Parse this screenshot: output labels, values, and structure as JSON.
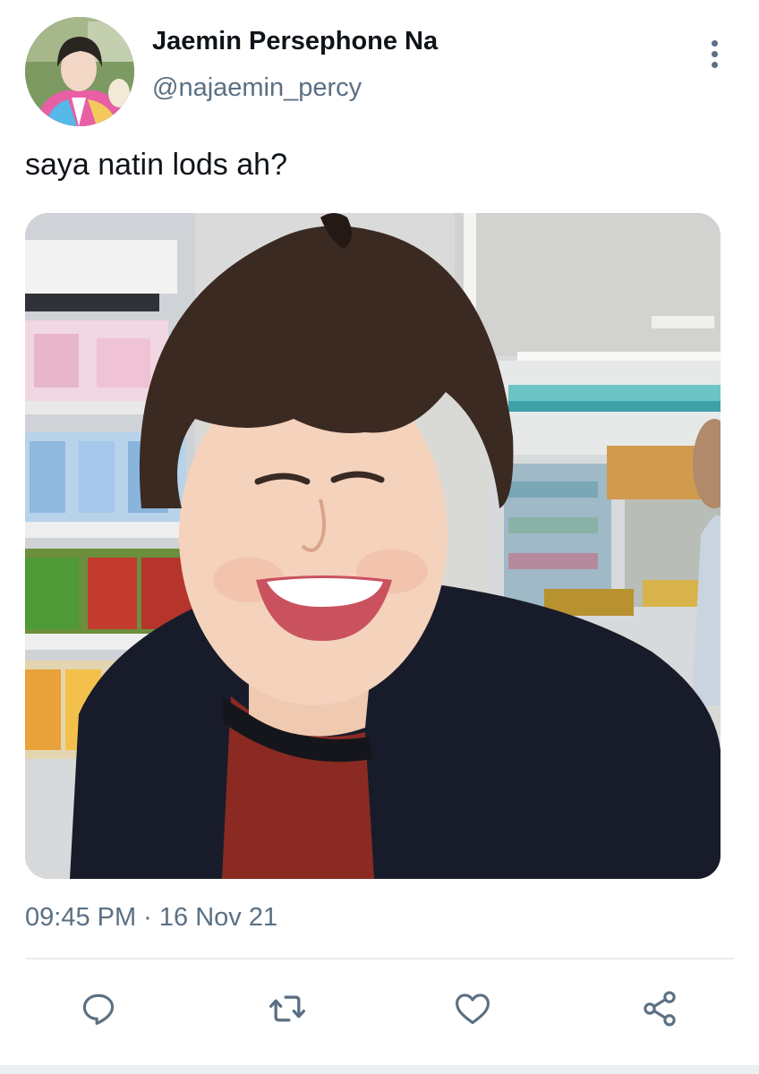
{
  "tweet": {
    "author": {
      "display_name": "Jaemin Persephone Na",
      "handle": "@najaemin_percy"
    },
    "text": "saya natin lods ah?",
    "timestamp": "09:45 PM · 16 Nov 21"
  },
  "actions": [
    {
      "name": "reply",
      "icon": "speech-bubble-icon"
    },
    {
      "name": "retweet",
      "icon": "retweet-arrows-icon"
    },
    {
      "name": "like",
      "icon": "heart-icon"
    },
    {
      "name": "share",
      "icon": "share-nodes-icon"
    }
  ],
  "colors": {
    "primary_text": "#0f1419",
    "secondary_text": "#5b7083",
    "divider": "#e6ecf0"
  }
}
